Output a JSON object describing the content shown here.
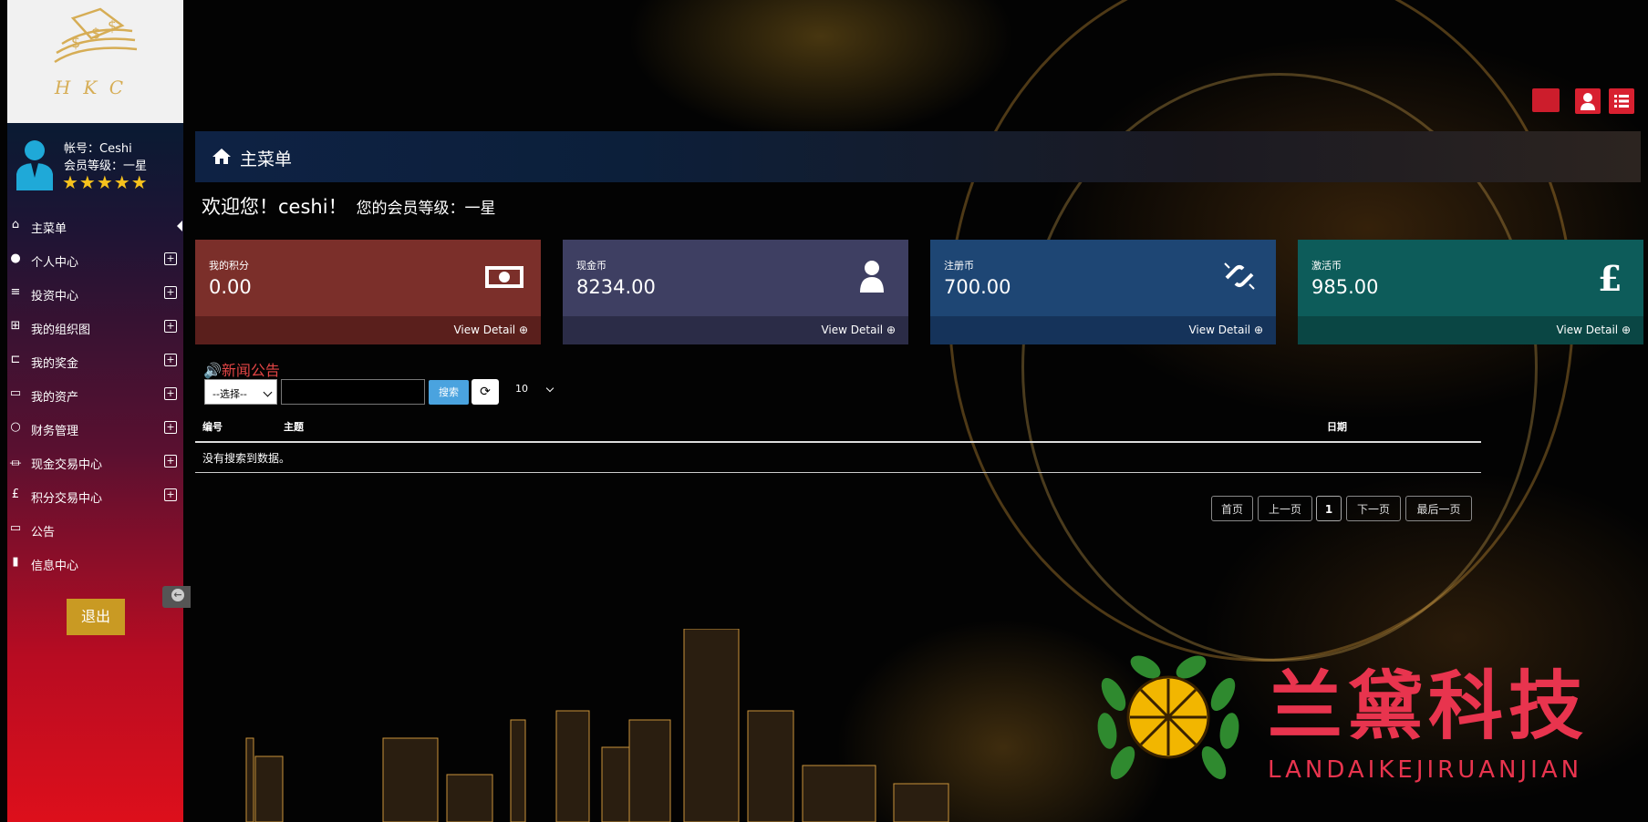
{
  "logo": {
    "text": "HKC"
  },
  "user": {
    "account": "帐号：Ceshi",
    "level": "会员等级：一星",
    "stars": "★★★★★"
  },
  "menu": [
    {
      "label": "主菜单",
      "icon": "home-icon"
    },
    {
      "label": "个人中心",
      "icon": "user-icon"
    },
    {
      "label": "投资中心",
      "icon": "database-icon"
    },
    {
      "label": "我的组织图",
      "icon": "sitemap-icon"
    },
    {
      "label": "我的奖金",
      "icon": "cart-icon"
    },
    {
      "label": "我的资产",
      "icon": "credit-card-icon"
    },
    {
      "label": "财务管理",
      "icon": "circle-icon"
    },
    {
      "label": "现金交易中心",
      "icon": "bank-icon"
    },
    {
      "label": "积分交易中心",
      "icon": "pound-icon"
    },
    {
      "label": "公告",
      "icon": "desktop-icon"
    },
    {
      "label": "信息中心",
      "icon": "bar-chart-icon"
    }
  ],
  "logout_label": "退出",
  "header": {
    "title": "主菜单"
  },
  "welcome": {
    "greeting": "欢迎您！",
    "name": "ceshi",
    "suffix": "！",
    "level": "您的会员等级：一星"
  },
  "cards": [
    {
      "label": "我的积分",
      "value": "0.00",
      "detail": "View Detail ⊕",
      "icon": "money-icon",
      "color_top": "#7b2f2a",
      "color_bottom": "#5a1f1c"
    },
    {
      "label": "现金币",
      "value": "8234.00",
      "detail": "View Detail ⊕",
      "icon": "user-icon",
      "color_top": "#3e3f62",
      "color_bottom": "#2b2c47"
    },
    {
      "label": "注册币",
      "value": "700.00",
      "detail": "View Detail ⊕",
      "icon": "broken-link-icon",
      "color_top": "#1e4674",
      "color_bottom": "#15335a"
    },
    {
      "label": "激活币",
      "value": "985.00",
      "detail": "View Detail ⊕",
      "icon": "pound-icon",
      "color_top": "#0d5c5a",
      "color_bottom": "#0a4644"
    }
  ],
  "news": {
    "title": "新闻公告",
    "select_value": "--选择--",
    "search_label": "搜索",
    "page_size": "10",
    "columns": {
      "id": "编号",
      "subject": "主题",
      "date": "日期"
    },
    "empty_text": "没有搜索到数据。"
  },
  "pagination": {
    "first": "首页",
    "prev": "上一页",
    "current": "1",
    "next": "下一页",
    "last": "最后一页"
  },
  "watermark": {
    "title": "兰黛科技",
    "subtitle": "LANDAIKEJIRUANJIAN"
  }
}
